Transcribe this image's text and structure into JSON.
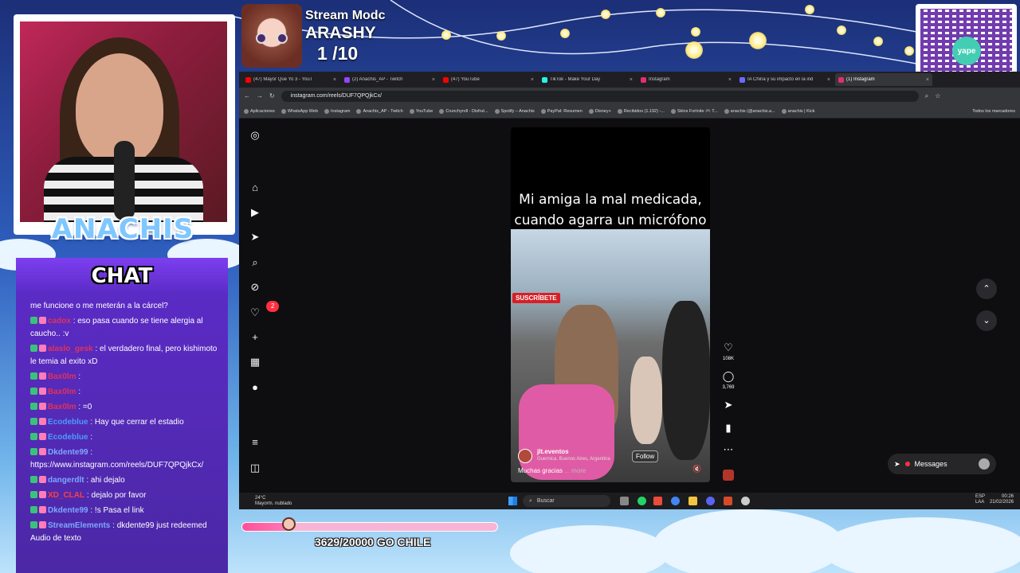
{
  "stream": {
    "mode_label": "Stream Modc",
    "name": "ARASHY",
    "counter": "1 /10",
    "streamer_name": "ANACHIS",
    "goal_text": "3629/20000 GO CHILE",
    "goal_progress": 0.18
  },
  "qr": {
    "logo_text": "yape"
  },
  "chat": {
    "title": "CHAT",
    "messages": [
      {
        "user": "",
        "text": "me funcione o me meterán a la cárcel?",
        "color": "#ffffff"
      },
      {
        "user": "cadox",
        "text": ": eso pasa cuando se tiene alergia al caucho.. :v",
        "color": "#e0325a"
      },
      {
        "user": "alaslo_gesk",
        "text": ": el verdadero final, pero kishimoto le temia al exito xD",
        "color": "#e0325a"
      },
      {
        "user": "Bax0lm",
        "text": ":",
        "color": "#e0325a"
      },
      {
        "user": "Bax0lm",
        "text": ":",
        "color": "#e0325a"
      },
      {
        "user": "Bax0lm",
        "text": ": =0",
        "color": "#e0325a"
      },
      {
        "user": "Ecodeblue",
        "text": ": Hay que cerrar el estadio",
        "color": "#4b9bff"
      },
      {
        "user": "Ecodeblue",
        "text": ":",
        "color": "#4b9bff"
      },
      {
        "user": "Dkdente99",
        "text": ": https://www.instagram.com/reels/DUF7QPQjkCx/",
        "color": "#7da8ff"
      },
      {
        "user": "dangerdlt",
        "text": ": ahi dejalo",
        "color": "#7da8ff"
      },
      {
        "user": "XD_CLAL",
        "text": ": dejalo por favor",
        "color": "#ff4040"
      },
      {
        "user": "Dkdente99",
        "text": ": !s Pasa el link",
        "color": "#7da8ff"
      },
      {
        "user": "StreamElements",
        "text": ": dkdente99 just redeemed Audio de texto",
        "color": "#7da8ff"
      }
    ]
  },
  "browser": {
    "tabs": [
      {
        "label": "(47) Mayor Que Yo 3 - YouT",
        "color": "#ff0000",
        "active": false
      },
      {
        "label": "(2) Anachis_AP - Twitch",
        "color": "#9146ff",
        "active": false
      },
      {
        "label": "(47) YouTube",
        "color": "#ff0000",
        "active": false
      },
      {
        "label": "TikTok - Make Your Day",
        "color": "#25f4ee",
        "active": false
      },
      {
        "label": "Instagram",
        "color": "#e1306c",
        "active": false
      },
      {
        "label": "IA China y su impacto en la ind",
        "color": "#6a6aff",
        "active": false
      },
      {
        "label": "(1) Instagram",
        "color": "#e1306c",
        "active": true
      }
    ],
    "url": "instagram.com/reels/DUF7QPQjkCx/",
    "bookmarks": [
      "Aplicaciones",
      "WhatsApp Web",
      "Instagram",
      "Anachis_AP - Twitch",
      "YouTube",
      "Crunchyroll - Disfrut...",
      "Spotify – Anachis",
      "PayPal: Resumen",
      "Disney+",
      "Recibidos (1.192) -...",
      "Skins Fortnite 🎮 T...",
      "anachis (@anachis.a...",
      "anachis | Kick"
    ],
    "bookmarks_all": "Todos los marcadores"
  },
  "instagram": {
    "reel_caption": [
      "Mi amiga la mal medicada,",
      "cuando agarra un micrófono"
    ],
    "video_subscribe": "SUSCRÍBETE",
    "reel_user": "jlt.eventos",
    "reel_location": "Guernica, Buenos Aires, Argentina",
    "follow_label": "Follow",
    "reel_desc": "Muchas gracias",
    "more_label": "... more",
    "likes": "108K",
    "comments": "3,769",
    "notifications_badge": "2",
    "messages_label": "Messages"
  },
  "taskbar": {
    "weather_temp": "24°C",
    "weather_desc": "Mayorm. nublado",
    "search_placeholder": "Buscar",
    "lang": "ESP\nLAA",
    "time": "00:26",
    "date": "21/02/2026"
  }
}
